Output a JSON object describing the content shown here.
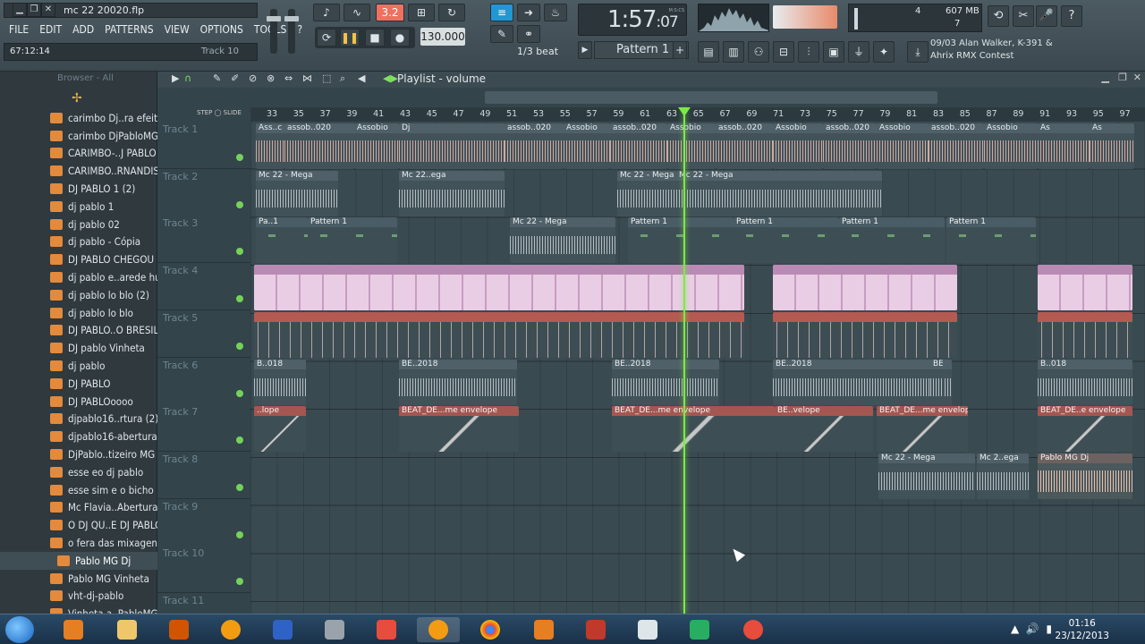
{
  "window": {
    "title": "mc 22 20020.flp",
    "hint_left": "67:12:14",
    "hint_right": "Track 10"
  },
  "menu": [
    "FILE",
    "EDIT",
    "ADD",
    "PATTERNS",
    "VIEW",
    "OPTIONS",
    "TOOLS",
    "?"
  ],
  "transport": {
    "mode_label": "3.2",
    "tempo": "130.000",
    "snap": "1/3 beat",
    "time_main": "1:57",
    "time_sub": ":07",
    "time_unit": "M:S:CS",
    "pattern": "Pattern 1",
    "cpu_value": "4",
    "memory": "607 MB",
    "poly": "7"
  },
  "news": {
    "date": "09/03",
    "line1": "Alan Walker, K-391 &",
    "line2": "Ahrix RMX Contest"
  },
  "browser": {
    "title": "Browser - All",
    "items": [
      "carimbo Dj..ra efeito",
      "carimbo DjPabloMG",
      "CARIMBO-..J PABLO",
      "CARIMBO..RNANDIS",
      "DJ PABLO 1 (2)",
      "dj pablo 1",
      "dj pablo 02",
      "dj pablo - Cópia",
      "DJ PABLO CHEGOU",
      "dj pablo e..arede hu",
      "dj pablo lo blo (2)",
      "dj pablo lo blo",
      "DJ PABLO..O BRESIL",
      "DJ pablo Vinheta",
      "dj pablo",
      "DJ PABLO",
      "DJ PABLOoooo",
      "djpablo16..rtura (2)",
      "djpablo16-abertura",
      "DjPablo..tizeiro MG",
      "esse eo dj pablo",
      "esse sim e o bicho",
      "Mc Flavia..Abertura",
      "O DJ QU..E DJ PABLO",
      "o fera das mixagens",
      "Pablo MG Dj",
      "Pablo MG Vinheta",
      "vht-dj-pablo",
      "Vinheta a..PabloMG"
    ],
    "selected_index": 25
  },
  "playlist": {
    "title": "Playlist - volume",
    "ruler": [
      "33",
      "35",
      "37",
      "39",
      "41",
      "43",
      "45",
      "47",
      "49",
      "51",
      "53",
      "55",
      "57",
      "59",
      "61",
      "63",
      "65",
      "67",
      "69",
      "71",
      "73",
      "75",
      "77",
      "79",
      "81",
      "83",
      "85",
      "87",
      "89",
      "91",
      "93",
      "95",
      "97"
    ],
    "tracks": [
      "Track 1",
      "Track 2",
      "Track 3",
      "Track 4",
      "Track 5",
      "Track 6",
      "Track 7",
      "Track 8",
      "Track 9",
      "Track 10",
      "Track 11"
    ],
    "clips": {
      "t1": [
        "Ass..c",
        "assob..020",
        "Assobio",
        "Dj",
        "assob..020",
        "Assobio",
        "assob..020",
        "Assobio",
        "assob..020",
        "Assobio",
        "assob..020",
        "Assobio",
        "assob..020",
        "Assobio",
        "As",
        "As"
      ],
      "t2": [
        "Mc 22 - Mega",
        "Mc 22..ega",
        "Mc 22 - Mega",
        "Mc 22 - Mega"
      ],
      "t3": [
        "Pa..1",
        "Pattern 1",
        "Mc 22 - Mega",
        "Pattern 1",
        "Pattern 1",
        "Pattern 1",
        "Pattern 1"
      ],
      "t6": [
        "B..018",
        "BE..2018",
        "BE..2018",
        "BE..2018",
        "BE..2018",
        "B..018"
      ],
      "t7": [
        "..lope",
        "BEAT_DE...me envelope",
        "BEAT_DE...me envelope",
        "BE..velope",
        "BEAT_DE...me envelope",
        "BE..velope",
        "BEAT_DE..e envelope"
      ],
      "t8": [
        "Mc 22 - Mega",
        "Mc 2..ega",
        "Pablo MG Dj"
      ]
    }
  },
  "taskbar": {
    "time": "01:16",
    "date": "23/12/2013"
  }
}
